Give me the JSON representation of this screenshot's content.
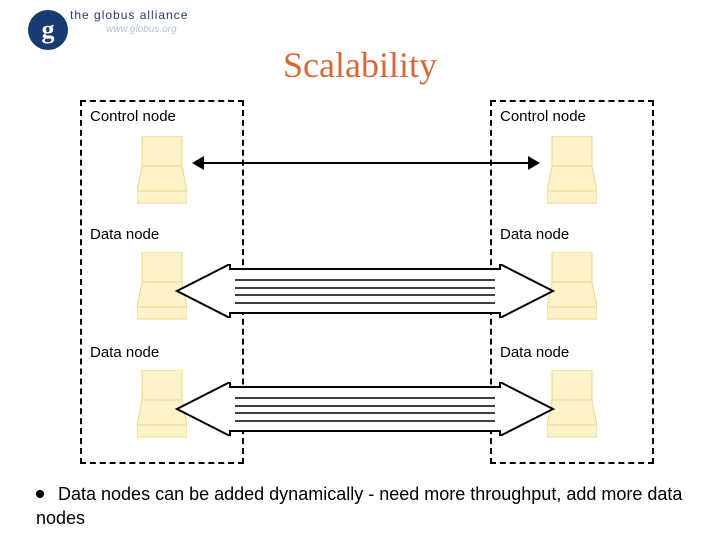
{
  "brand": {
    "glyph": "g",
    "text": "the globus alliance",
    "sub": "www.globus.org"
  },
  "title": "Scalability",
  "left_cluster": {
    "nodes": [
      "Control node",
      "Data node",
      "Data node"
    ]
  },
  "right_cluster": {
    "nodes": [
      "Control node",
      "Data node",
      "Data node"
    ]
  },
  "bullet": "Data nodes can be added dynamically - need more throughput, add more data nodes"
}
